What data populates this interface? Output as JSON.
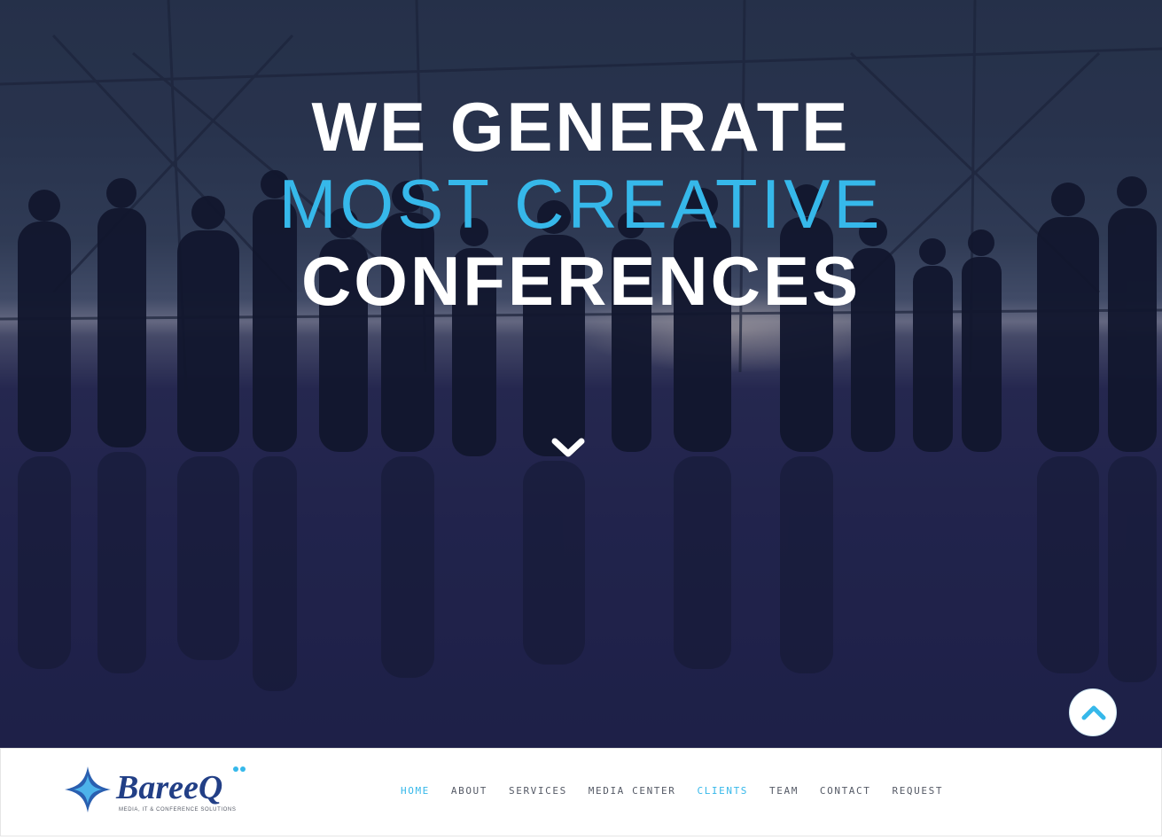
{
  "hero": {
    "title_line1": "WE GENERATE",
    "title_line2": "MOST CREATIVE",
    "title_line3": "CONFERENCES"
  },
  "logo": {
    "brand": "BareeQ",
    "tagline": "MEDIA, IT & CONFERENCE SOLUTIONS"
  },
  "nav": {
    "items": [
      {
        "label": "HOME",
        "active": true
      },
      {
        "label": "ABOUT",
        "active": false
      },
      {
        "label": "SERVICES",
        "active": false
      },
      {
        "label": "MEDIA CENTER",
        "active": false
      },
      {
        "label": "CLIENTS",
        "active": true
      },
      {
        "label": "TEAM",
        "active": false
      },
      {
        "label": "CONTACT",
        "active": false
      },
      {
        "label": "REQUEST",
        "active": false
      }
    ]
  },
  "icons": {
    "scroll_down": "chevron-down-icon",
    "back_to_top": "chevron-up-icon"
  },
  "colors": {
    "accent": "#36b8ea",
    "hero_overlay": "#242650",
    "nav_text": "#555a66"
  }
}
